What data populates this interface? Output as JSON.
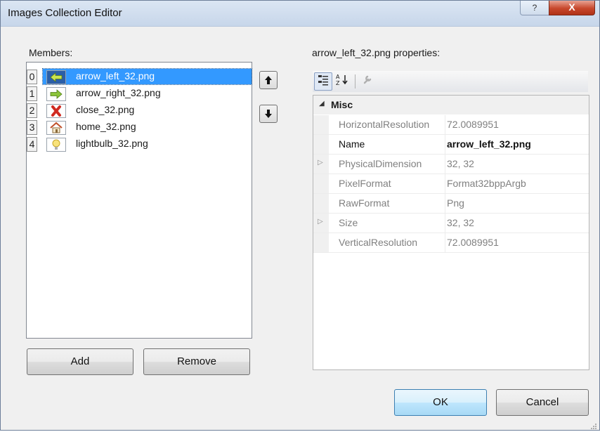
{
  "window": {
    "title": "Images Collection Editor",
    "help_label": "?",
    "close_label": "X"
  },
  "members": {
    "label": "Members:",
    "items": [
      {
        "index": "0",
        "name": "arrow_left_32.png",
        "icon": "arrow-left-icon",
        "selected": true
      },
      {
        "index": "1",
        "name": "arrow_right_32.png",
        "icon": "arrow-right-icon",
        "selected": false
      },
      {
        "index": "2",
        "name": "close_32.png",
        "icon": "close-icon",
        "selected": false
      },
      {
        "index": "3",
        "name": "home_32.png",
        "icon": "home-icon",
        "selected": false
      },
      {
        "index": "4",
        "name": "lightbulb_32.png",
        "icon": "lightbulb-icon",
        "selected": false
      }
    ],
    "move_up_label": "🡅",
    "move_down_label": "🡇",
    "add_label": "Add",
    "remove_label": "Remove"
  },
  "properties": {
    "label": "arrow_left_32.png properties:",
    "toolbar": {
      "categorized_icon": "categorized-icon",
      "alphabetical_icon": "sort-alphabetical-icon",
      "property_pages_icon": "property-pages-icon"
    },
    "category": "Misc",
    "rows": [
      {
        "name": "HorizontalResolution",
        "value": "72.0089951",
        "expandable": false,
        "editable": false
      },
      {
        "name": "Name",
        "value": "arrow_left_32.png",
        "expandable": false,
        "editable": true
      },
      {
        "name": "PhysicalDimension",
        "value": "32, 32",
        "expandable": true,
        "editable": false
      },
      {
        "name": "PixelFormat",
        "value": "Format32bppArgb",
        "expandable": false,
        "editable": false
      },
      {
        "name": "RawFormat",
        "value": "Png",
        "expandable": false,
        "editable": false
      },
      {
        "name": "Size",
        "value": "32, 32",
        "expandable": true,
        "editable": false
      },
      {
        "name": "VerticalResolution",
        "value": "72.0089951",
        "expandable": false,
        "editable": false
      }
    ]
  },
  "buttons": {
    "ok_label": "OK",
    "cancel_label": "Cancel"
  },
  "colors": {
    "selection": "#3399ff",
    "title_bar": "#c7d6ea",
    "close_button": "#c7472c"
  }
}
